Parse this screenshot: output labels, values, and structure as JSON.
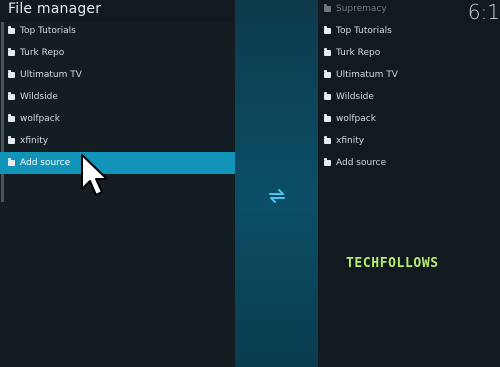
{
  "header": {
    "title": "File manager",
    "clock": "6:1"
  },
  "left_pane": {
    "items": [
      {
        "label": "Top Tutorials"
      },
      {
        "label": "Turk Repo"
      },
      {
        "label": "Ultimatum TV"
      },
      {
        "label": "Wildside"
      },
      {
        "label": "wolfpack"
      },
      {
        "label": "xfinity"
      },
      {
        "label": "Add source",
        "selected": true
      }
    ]
  },
  "right_pane": {
    "items": [
      {
        "label": "Supremacy"
      },
      {
        "label": "Top Tutorials"
      },
      {
        "label": "Turk Repo"
      },
      {
        "label": "Ultimatum TV"
      },
      {
        "label": "Wildside"
      },
      {
        "label": "wolfpack"
      },
      {
        "label": "xfinity"
      },
      {
        "label": "Add source"
      }
    ]
  },
  "center": {
    "icon": "swap-panes-icon"
  },
  "watermark": {
    "text": "TECHFOLLOWS"
  },
  "colors": {
    "accent": "#1294b8",
    "center_panel": "#0b4a60",
    "watermark": "#b7ec6a"
  }
}
